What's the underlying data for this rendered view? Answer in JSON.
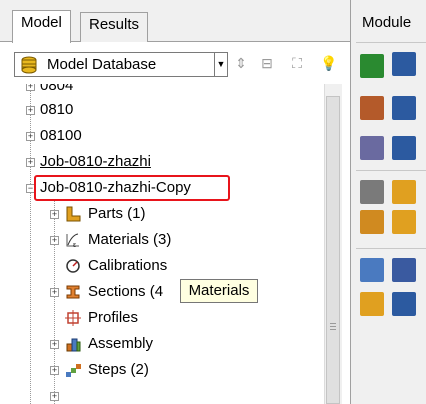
{
  "tabs": [
    {
      "label": "Model"
    },
    {
      "label": "Results"
    }
  ],
  "database_select": {
    "value": "Model Database"
  },
  "tree": {
    "items": [
      {
        "label": "0804"
      },
      {
        "label": "0810"
      },
      {
        "label": "08100"
      },
      {
        "label": "Job-0810-zhazhi"
      },
      {
        "label": "Job-0810-zhazhi-Copy"
      },
      {
        "label": "Parts (1)"
      },
      {
        "label": "Materials (3)"
      },
      {
        "label": "Calibrations"
      },
      {
        "label": "Sections (4"
      },
      {
        "label": "Profiles"
      },
      {
        "label": "Assembly"
      },
      {
        "label": "Steps (2)"
      }
    ]
  },
  "tooltip": {
    "text": "Materials"
  },
  "right_panel": {
    "title": "Module"
  },
  "colors": {
    "highlight": "#e8141b",
    "tooltip_bg": "#ffffe1"
  }
}
